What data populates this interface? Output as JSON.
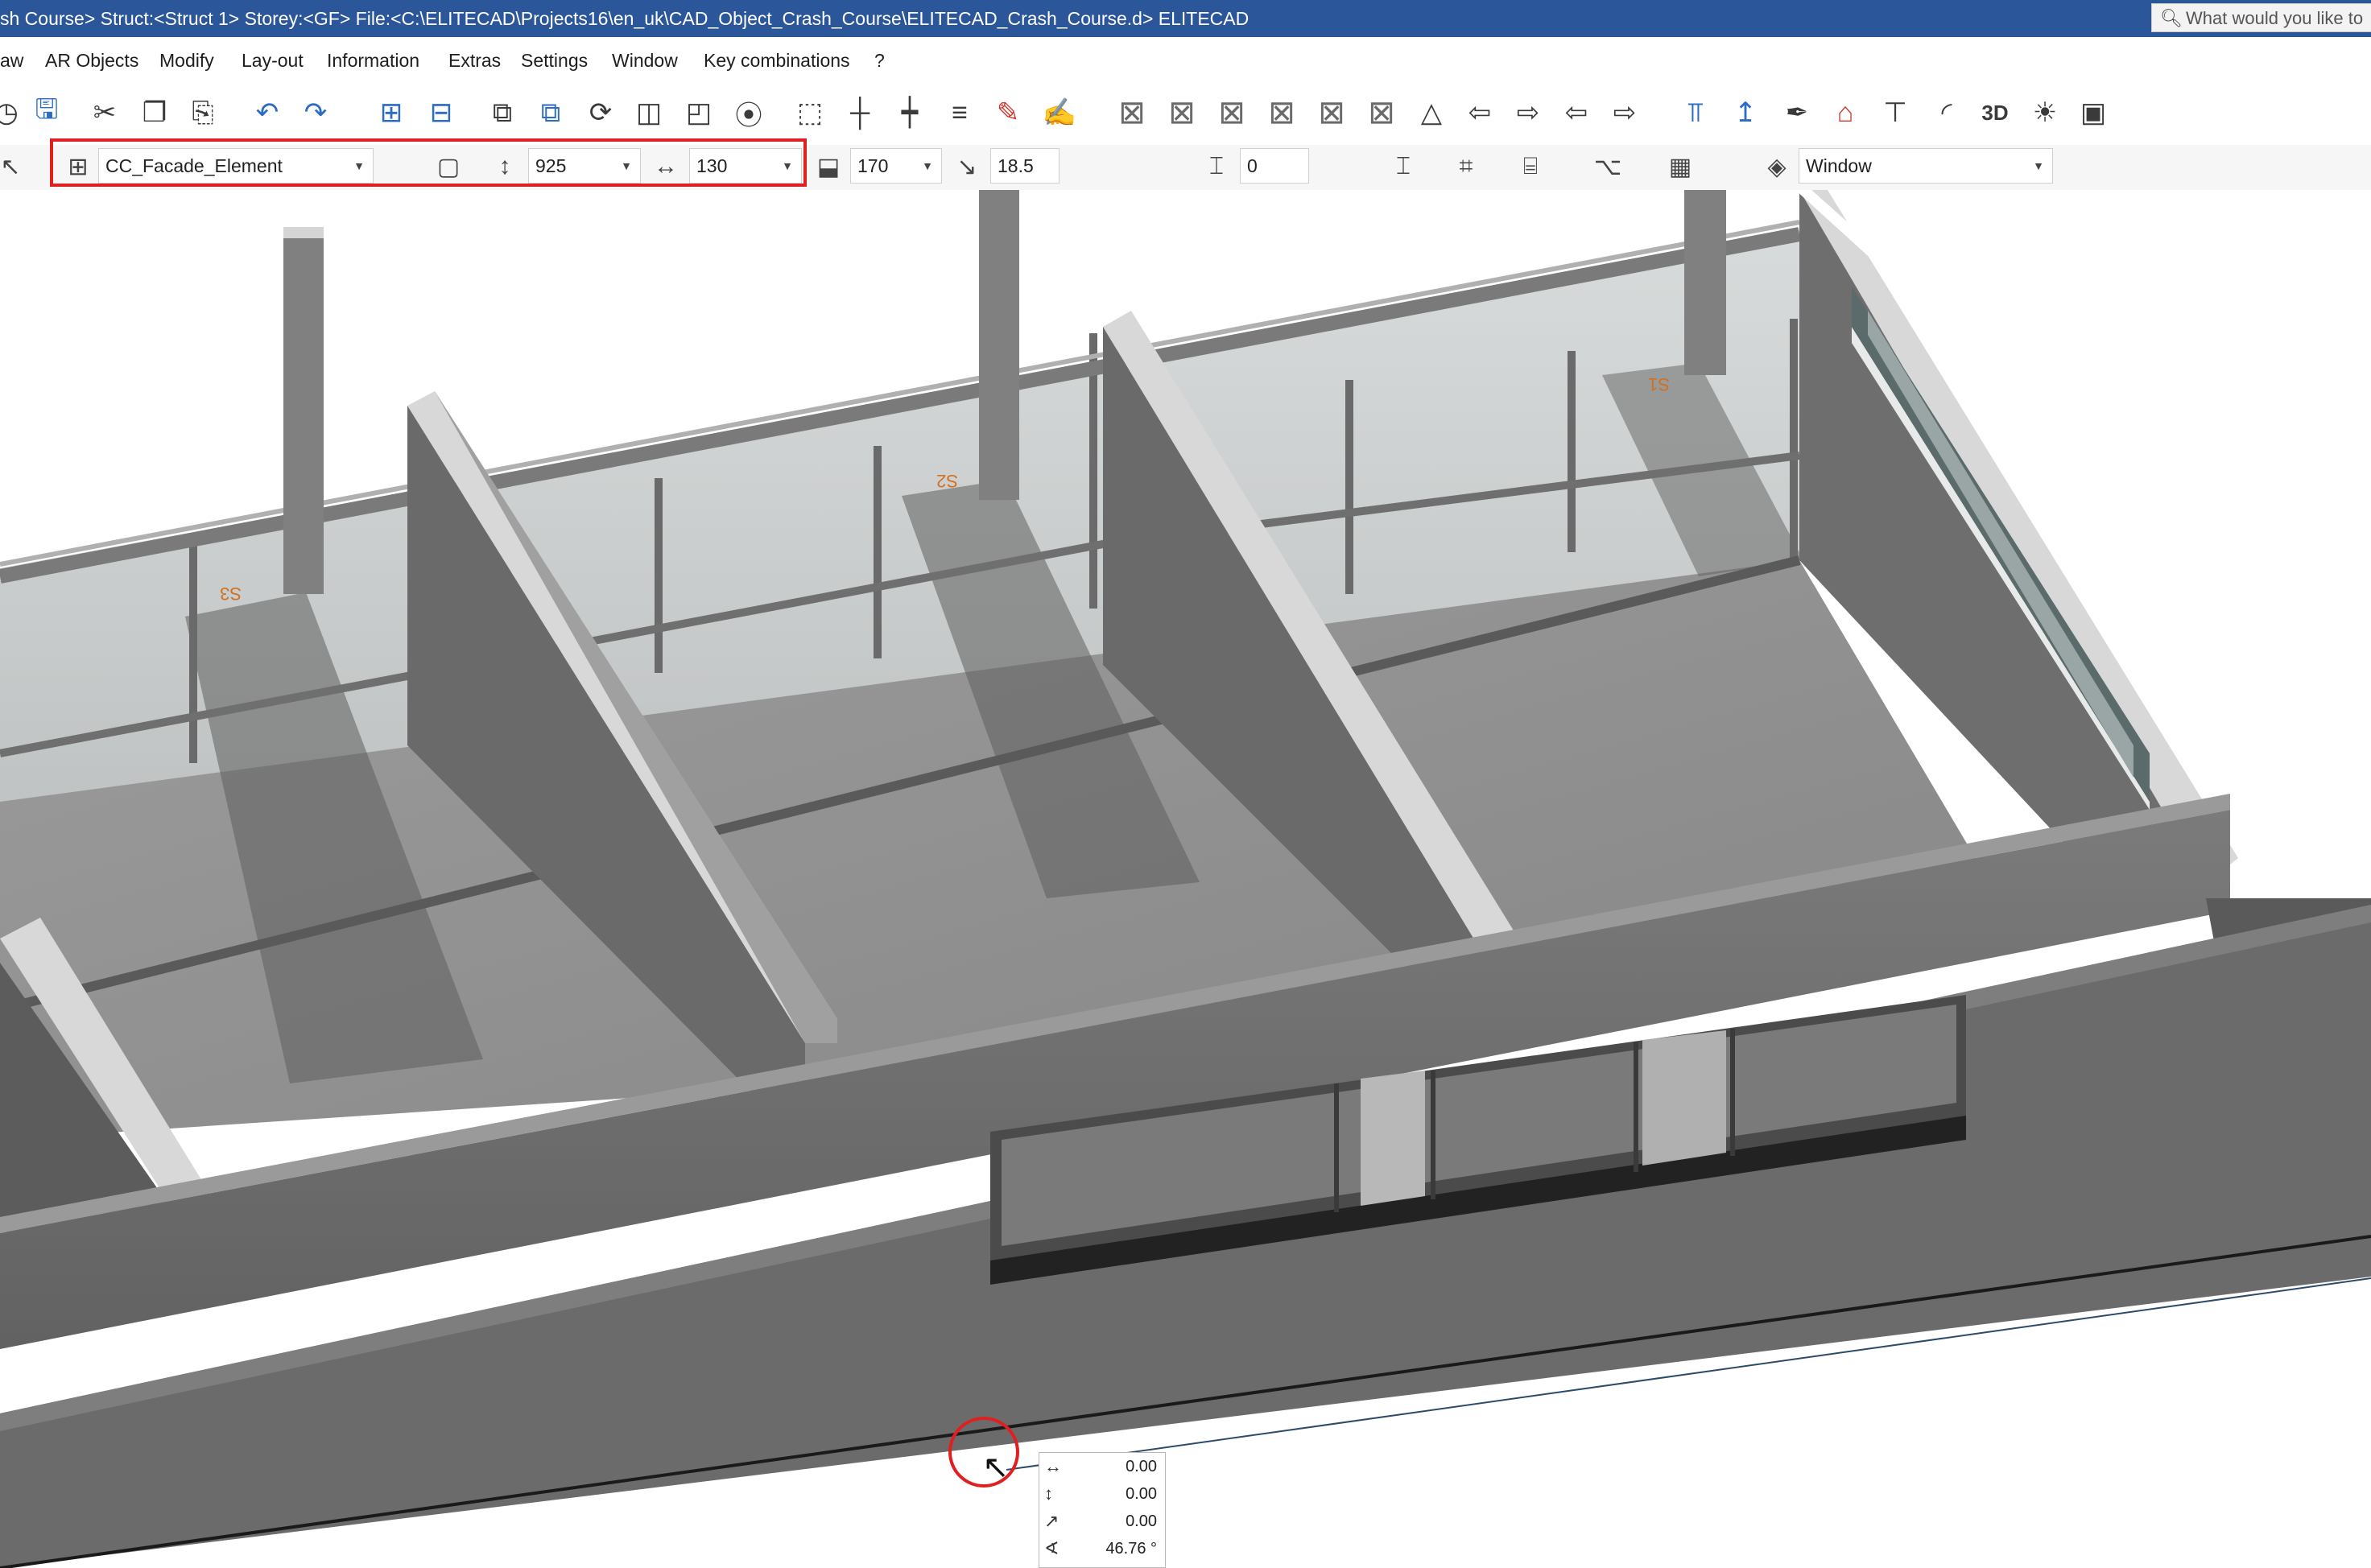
{
  "titlebar": {
    "title": "sh Course> Struct:<Struct 1>  Storey:<GF>  File:<C:\\ELITECAD\\Projects16\\en_uk\\CAD_Object_Crash_Course\\ELITECAD_Crash_Course.d>  ELITECAD",
    "search_placeholder": "What would you like to"
  },
  "menubar": {
    "items": [
      "aw",
      "AR Objects",
      "Modify",
      "Lay-out",
      "Information",
      "Extras",
      "Settings",
      "Window",
      "Key combinations",
      "?"
    ]
  },
  "properties": {
    "element": "CC_Facade_Element",
    "height": "925",
    "width": "130",
    "sill": "170",
    "offset": "18.5",
    "angle_field": "0",
    "layer": "Window"
  },
  "scene_labels": {
    "room_1": "S3",
    "room_2": "S2",
    "room_3": "S1"
  },
  "readout": {
    "dx": "0.00",
    "dy": "0.00",
    "dist": "0.00",
    "angle": "46.76 °"
  },
  "colors": {
    "titlebar": "#2b579a",
    "highlight": "#e02020",
    "floor": "#8e8e8e",
    "wall": "#6e6e6e",
    "slab_top": "#ffffff"
  },
  "icons": {
    "toolbar": [
      "history-icon",
      "save-icon",
      "cut-icon",
      "copy-icon",
      "paste-icon",
      "undo-icon",
      "redo-icon",
      "zoom-in-icon",
      "zoom-out-icon",
      "copy-object-icon",
      "duplicate-icon",
      "rotate-icon",
      "mirror-icon",
      "stretch-icon",
      "group-icon",
      "select-frame-icon",
      "split-icon",
      "cross-icon",
      "hatch-icon",
      "eraser-icon",
      "edit-object-icon",
      "view-box-1-icon",
      "view-box-2-icon",
      "view-box-3-icon",
      "view-box-4-icon",
      "view-box-5-icon",
      "view-box-6-icon",
      "pyramid-icon",
      "view-transform-1-icon",
      "view-transform-2-icon",
      "view-transform-3-icon",
      "view-transform-4-icon",
      "section-icon",
      "elevation-icon",
      "paint-icon",
      "house-icon",
      "column-icon",
      "arc-icon",
      "3d-icon",
      "light-icon",
      "camera-icon"
    ]
  }
}
